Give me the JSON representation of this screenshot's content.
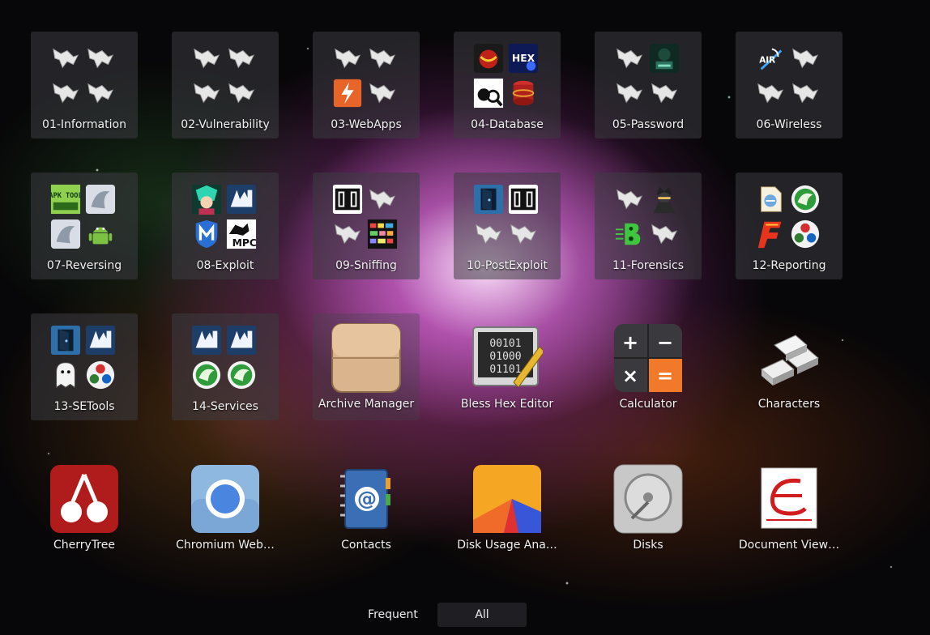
{
  "folders": [
    {
      "label": "01-Information",
      "icons": [
        "kali-dragon-icon",
        "kali-dragon-icon",
        "kali-dragon-icon",
        "kali-dragon-icon"
      ]
    },
    {
      "label": "02-Vulnerability",
      "icons": [
        "kali-dragon-icon",
        "kali-dragon-icon",
        "kali-dragon-icon",
        "kali-dragon-icon"
      ]
    },
    {
      "label": "03-WebApps",
      "icons": [
        "kali-dragon-icon",
        "kali-dragon-icon",
        "burpsuite-icon",
        "kali-dragon-icon"
      ]
    },
    {
      "label": "04-Database",
      "icons": [
        "jsql-icon",
        "hex-icon",
        "sqlmap-icon",
        "database-icon"
      ]
    },
    {
      "label": "05-Password",
      "icons": [
        "kali-dragon-icon",
        "hacker-icon",
        "kali-dragon-icon",
        "kali-dragon-icon"
      ]
    },
    {
      "label": "06-Wireless",
      "icons": [
        "aircrack-icon",
        "kali-dragon-icon",
        "kali-dragon-icon",
        "kali-dragon-icon"
      ]
    },
    {
      "label": "07-Reversing",
      "icons": [
        "apktool-icon",
        "ghidra-icon",
        "ghidra-icon",
        "android-icon"
      ]
    },
    {
      "label": "08-Exploit",
      "icons": [
        "armitage-icon",
        "beef-icon",
        "metasploit-icon",
        "msfpc-icon"
      ]
    },
    {
      "label": "09-Sniffing",
      "icons": [
        "responder-icon",
        "kali-dragon-icon",
        "kali-dragon-icon",
        "sniff-grid-icon"
      ]
    },
    {
      "label": "10-PostExploit",
      "icons": [
        "door-icon",
        "responder-icon",
        "kali-dragon-icon",
        "kali-dragon-icon"
      ]
    },
    {
      "label": "11-Forensics",
      "icons": [
        "kali-dragon-icon",
        "detective-icon",
        "bulk-extractor-icon",
        "kali-dragon-icon"
      ]
    },
    {
      "label": "12-Reporting",
      "icons": [
        "report-icon",
        "recordmydesktop-icon",
        "faraday-icon",
        "cherrytree-dots-icon"
      ]
    },
    {
      "label": "13-SETools",
      "icons": [
        "door-icon",
        "beef-icon",
        "ghost-phish-icon",
        "cherrytree-dots-icon"
      ]
    },
    {
      "label": "14-Services",
      "icons": [
        "beef-icon",
        "beef-icon",
        "recordmydesktop-icon",
        "recordmydesktop-icon"
      ]
    }
  ],
  "apps": [
    {
      "label": "Archive Manager",
      "icon": "archive-manager-icon"
    },
    {
      "label": "Bless Hex Editor",
      "icon": "bless-hex-editor-icon"
    },
    {
      "label": "Calculator",
      "icon": "calculator-icon"
    },
    {
      "label": "Characters",
      "icon": "characters-icon"
    },
    {
      "label": "CherryTree",
      "icon": "cherrytree-icon"
    },
    {
      "label": "Chromium Web…",
      "icon": "chromium-icon"
    },
    {
      "label": "Contacts",
      "icon": "contacts-icon"
    },
    {
      "label": "Disk Usage Ana…",
      "icon": "disk-usage-icon"
    },
    {
      "label": "Disks",
      "icon": "disks-icon"
    },
    {
      "label": "Document View…",
      "icon": "document-viewer-icon"
    }
  ],
  "switcher": {
    "frequent": "Frequent",
    "all": "All"
  },
  "calculator": {
    "plus": "+",
    "minus": "−",
    "times": "×",
    "equals": "="
  },
  "hex": {
    "text": "HEX"
  },
  "aircrack": {
    "text": "AIR"
  },
  "apktool": {
    "text": "APK TOOL"
  },
  "msfpc": {
    "text": "MPC"
  },
  "bless": {
    "line1": "00101",
    "line2": "01000",
    "line3": "01101"
  }
}
